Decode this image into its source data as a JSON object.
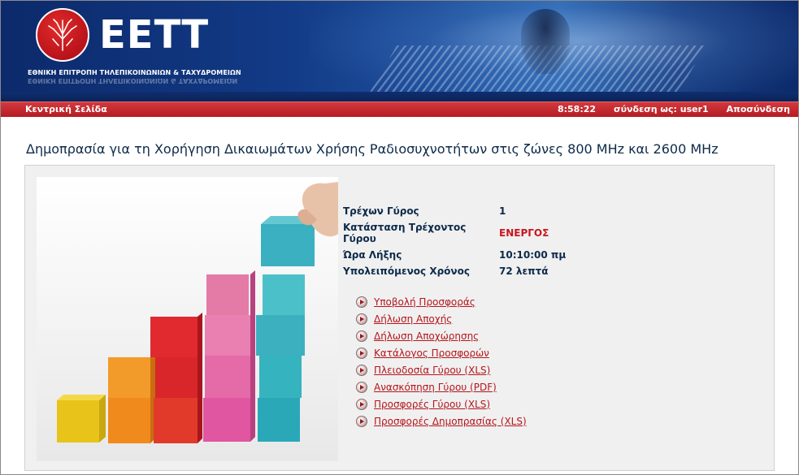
{
  "header": {
    "logo_text": "ΕΕΤΤ",
    "org_name": "ΕΘΝΙΚΗ ΕΠΙΤΡΟΠΗ ΤΗΛΕΠΙΚΟΙΝΩΝΙΩΝ & ΤΑΧΥΔΡΟΜΕΙΩΝ"
  },
  "nav": {
    "home": "Κεντρική Σελίδα",
    "time": "8:58:22",
    "logged_in": "σύνδεση ως: user1",
    "logout": "Αποσύνδεση"
  },
  "page": {
    "title": "Δημοπρασία για τη Χορήγηση Δικαιωμάτων Χρήσης Ραδιοσυχνοτήτων στις ζώνες 800 MHz και 2600 MHz"
  },
  "round_info": {
    "current_round_label": "Τρέχων Γύρος",
    "current_round_value": "1",
    "status_label": "Κατάσταση Τρέχοντος Γύρου",
    "status_value": "ΕΝΕΡΓΟΣ",
    "end_time_label": "Ώρα Λήξης",
    "end_time_value": "10:10:00 πμ",
    "remaining_label": "Υπολειπόμενος Χρόνος",
    "remaining_value": "72 λεπτά"
  },
  "menu": [
    "Υποβολή Προσφοράς",
    "Δήλωση Αποχής",
    "Δήλωση Αποχώρησης",
    "Κατάλογος Προσφορών",
    "Πλειοδοσία Γύρου (XLS)",
    "Ανασκόπηση Γύρου (PDF)",
    "Προσφορές Γύρου (XLS)",
    "Προσφορές Δημοπρασίας (XLS)"
  ],
  "colors": {
    "nav_red": "#c8161d",
    "banner_blue": "#123a86",
    "status_active": "#c8161d"
  }
}
